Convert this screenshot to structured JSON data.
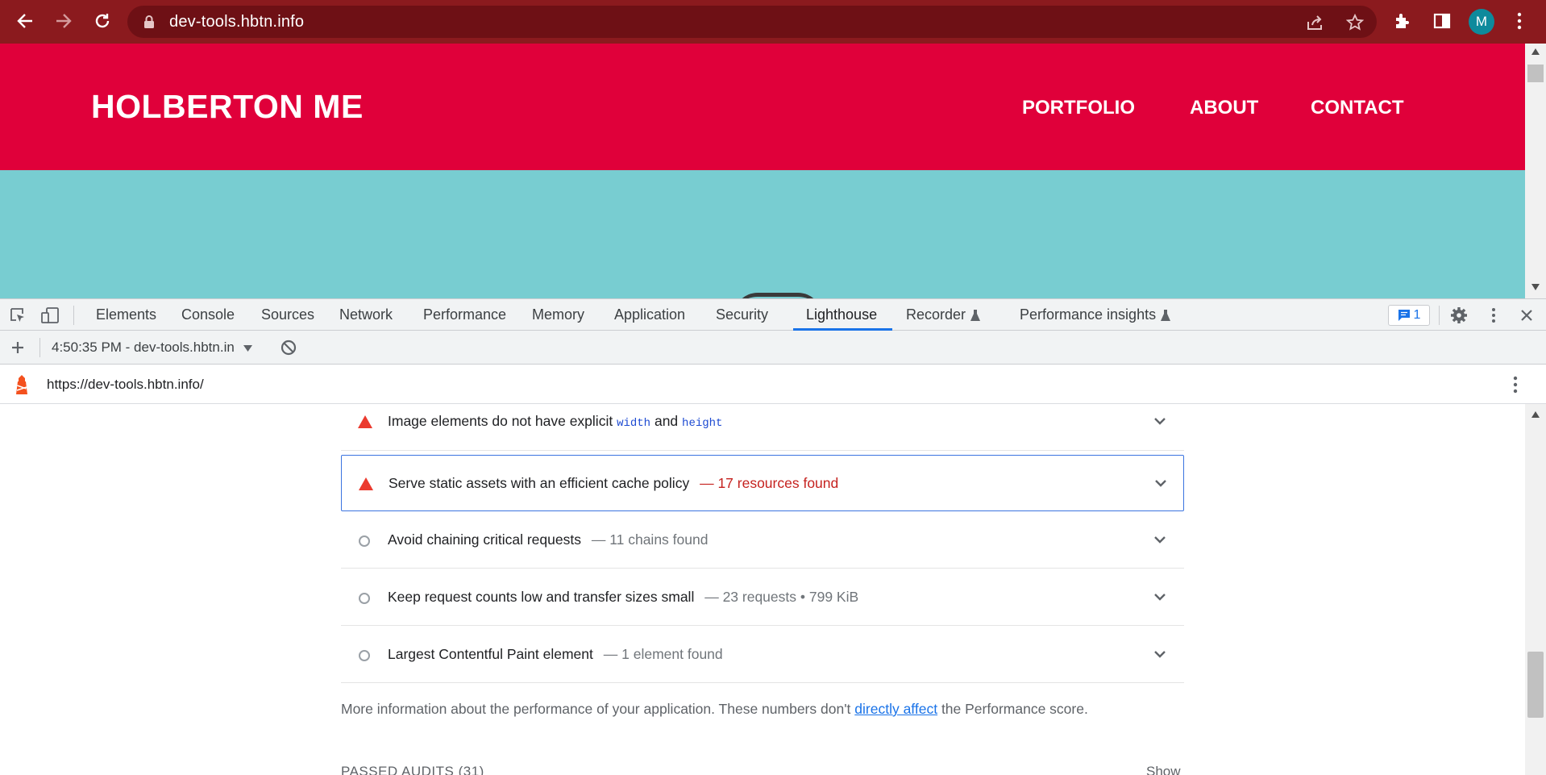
{
  "browser": {
    "url": "dev-tools.hbtn.info",
    "profile_initial": "M"
  },
  "site": {
    "logo": "HOLBERTON ME",
    "nav": [
      "PORTFOLIO",
      "ABOUT",
      "CONTACT"
    ],
    "header_color": "#e0003a",
    "hero_color": "#78cdd1"
  },
  "devtools": {
    "tabs": [
      "Elements",
      "Console",
      "Sources",
      "Network",
      "Performance",
      "Memory",
      "Application",
      "Security",
      "Lighthouse",
      "Recorder",
      "Performance insights"
    ],
    "active_tab": "Lighthouse",
    "issues_count": "1",
    "run_label": "4:50:35 PM - dev-tools.hbtn.in",
    "report_url": "https://dev-tools.hbtn.info/"
  },
  "report": {
    "audits": [
      {
        "status": "fail",
        "title": "Image elements do not have explicit",
        "code1": "width",
        "connector": "and",
        "code2": "height",
        "display": ""
      },
      {
        "status": "fail",
        "title": "Serve static assets with an efficient cache policy",
        "display": "— 17 resources found"
      },
      {
        "status": "info",
        "title": "Avoid chaining critical requests",
        "display": "— 11 chains found"
      },
      {
        "status": "info",
        "title": "Keep request counts low and transfer sizes small",
        "display": "— 23 requests • 799 KiB"
      },
      {
        "status": "info",
        "title": "Largest Contentful Paint element",
        "display": "— 1 element found"
      }
    ],
    "note_prefix": "More information about the performance of your application. These numbers don't",
    "note_link": "directly affect",
    "note_suffix": "the Performance score.",
    "passed_label": "PASSED AUDITS",
    "passed_count": "(31)",
    "show_label": "Show"
  }
}
